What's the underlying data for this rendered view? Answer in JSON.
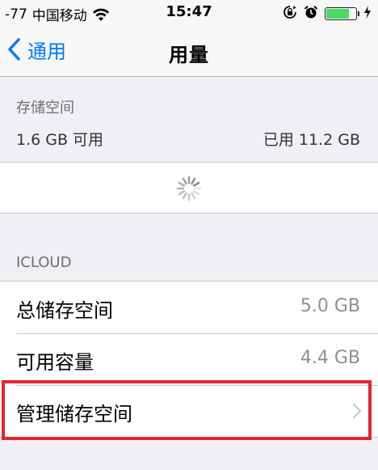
{
  "status_bar": {
    "signal": "-77",
    "carrier": "中国移动",
    "time": "15:47"
  },
  "nav": {
    "back_label": "通用",
    "title": "用量"
  },
  "storage": {
    "header": "存储空间",
    "available": "1.6 GB 可用",
    "used": "已用 11.2 GB"
  },
  "icloud": {
    "header": "ICLOUD",
    "rows": [
      {
        "label": "总储存空间",
        "value": "5.0 GB"
      },
      {
        "label": "可用容量",
        "value": "4.4 GB"
      },
      {
        "label": "管理储存空间",
        "value": ""
      }
    ]
  },
  "colors": {
    "accent": "#007aff",
    "highlight": "#e3262e",
    "battery": "#4cd964"
  },
  "battery_level": 0.8
}
